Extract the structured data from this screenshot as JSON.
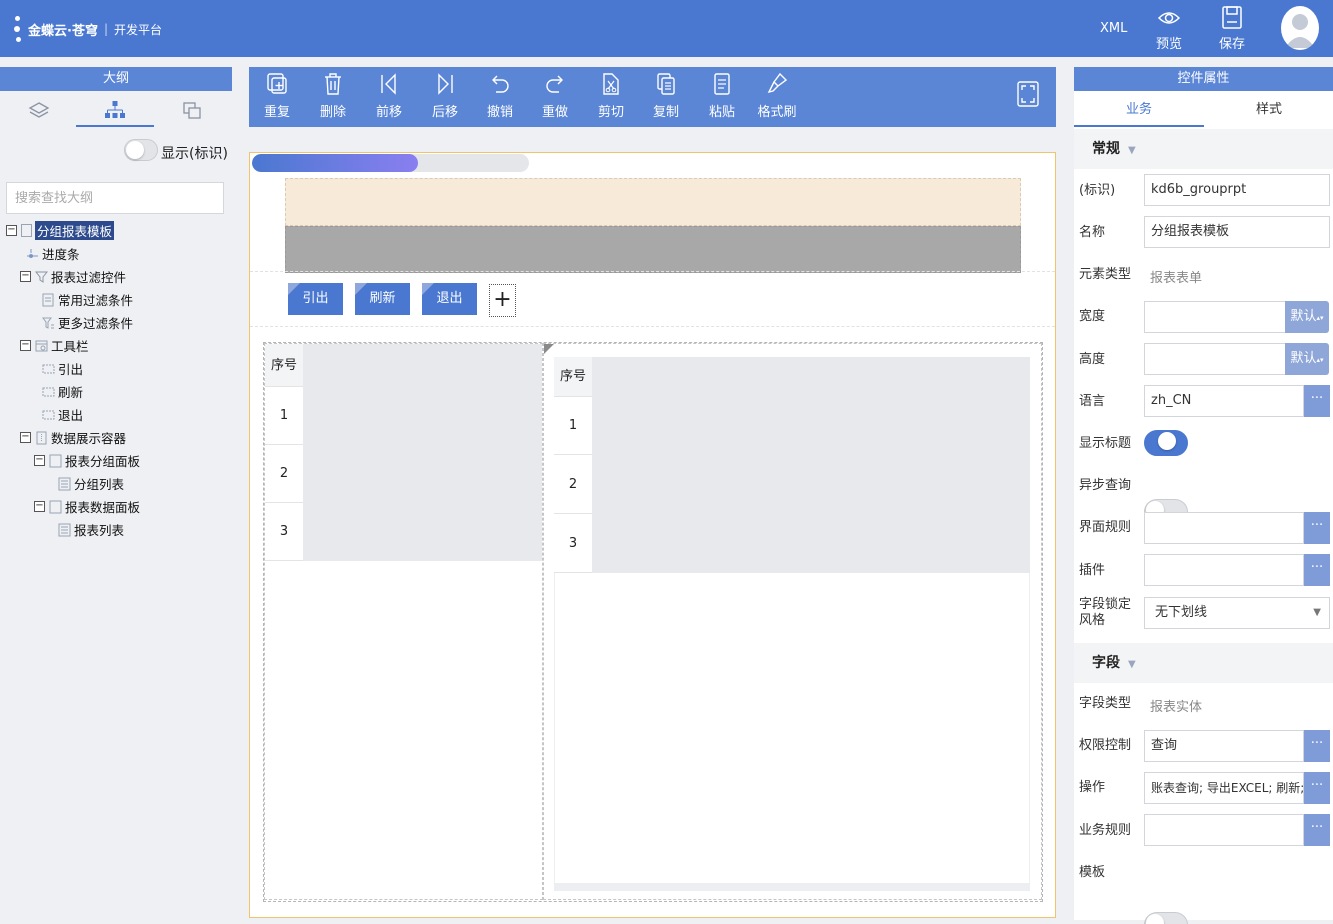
{
  "header": {
    "brand": "金蝶云·苍穹",
    "subtitle": "开发平台",
    "xml_label": "XML",
    "preview_label": "预览",
    "save_label": "保存",
    "bg_color": "#4a78d0"
  },
  "outline": {
    "title": "大纲",
    "show_id_label": "显示(标识)",
    "search_placeholder": "搜索查找大纲",
    "tree": [
      {
        "label": "分组报表模板",
        "icon": "form-icon"
      },
      {
        "label": "进度条",
        "icon": "progress-icon"
      },
      {
        "label": "报表过滤控件",
        "icon": "filter-icon"
      },
      {
        "label": "常用过滤条件",
        "icon": "filter-list-icon"
      },
      {
        "label": "更多过滤条件",
        "icon": "filter-more-icon"
      },
      {
        "label": "工具栏",
        "icon": "toolbar-icon"
      },
      {
        "label": "引出",
        "icon": "button-icon"
      },
      {
        "label": "刷新",
        "icon": "button-icon"
      },
      {
        "label": "退出",
        "icon": "button-icon"
      },
      {
        "label": "数据展示容器",
        "icon": "container-icon"
      },
      {
        "label": "报表分组面板",
        "icon": "panel-icon"
      },
      {
        "label": "分组列表",
        "icon": "list-icon"
      },
      {
        "label": "报表数据面板",
        "icon": "panel-icon"
      },
      {
        "label": "报表列表",
        "icon": "list-icon"
      }
    ]
  },
  "toolbar": {
    "buttons": [
      {
        "label": "重复",
        "icon": "duplicate-icon"
      },
      {
        "label": "删除",
        "icon": "delete-icon"
      },
      {
        "label": "前移",
        "icon": "move-prev-icon"
      },
      {
        "label": "后移",
        "icon": "move-next-icon"
      },
      {
        "label": "撤销",
        "icon": "undo-icon"
      },
      {
        "label": "重做",
        "icon": "redo-icon"
      },
      {
        "label": "剪切",
        "icon": "cut-icon"
      },
      {
        "label": "复制",
        "icon": "copy-icon"
      },
      {
        "label": "粘贴",
        "icon": "paste-icon"
      },
      {
        "label": "格式刷",
        "icon": "format-brush-icon"
      }
    ]
  },
  "canvas": {
    "progress_fraction": 0.6,
    "buttons": [
      "引出",
      "刷新",
      "退出"
    ],
    "add_label": "+",
    "group_grid": {
      "header": "序号",
      "rows": [
        "1",
        "2",
        "3"
      ]
    },
    "data_grid": {
      "header": "序号",
      "rows": [
        "1",
        "2",
        "3"
      ]
    }
  },
  "props": {
    "title": "控件属性",
    "tabs": [
      "业务",
      "样式"
    ],
    "general_section": "常规",
    "field_section": "字段",
    "id_label": "(标识)",
    "id_value": "kd6b_grouprpt",
    "name_label": "名称",
    "name_value": "分组报表模板",
    "element_type_label": "元素类型",
    "element_type_value": "报表表单",
    "width_label": "宽度",
    "width_value": "",
    "height_label": "高度",
    "height_value": "",
    "default_label": "默认",
    "language_label": "语言",
    "language_value": "zh_CN",
    "show_title_label": "显示标题",
    "show_title_on": true,
    "async_query_label": "异步查询",
    "async_query_on": false,
    "ui_rule_label": "界面规则",
    "ui_rule_value": "",
    "plugin_label": "插件",
    "plugin_value": "",
    "field_lock_label": "字段锁定风格",
    "field_lock_value": "无下划线",
    "field_type_label": "字段类型",
    "field_type_value": "报表实体",
    "permission_label": "权限控制",
    "permission_value": "查询",
    "operation_label": "操作",
    "operation_value": "账表查询; 导出EXCEL; 刷新;",
    "biz_rule_label": "业务规则",
    "biz_rule_value": "",
    "template_label": "模板",
    "template_on": false,
    "more_label": "···"
  }
}
